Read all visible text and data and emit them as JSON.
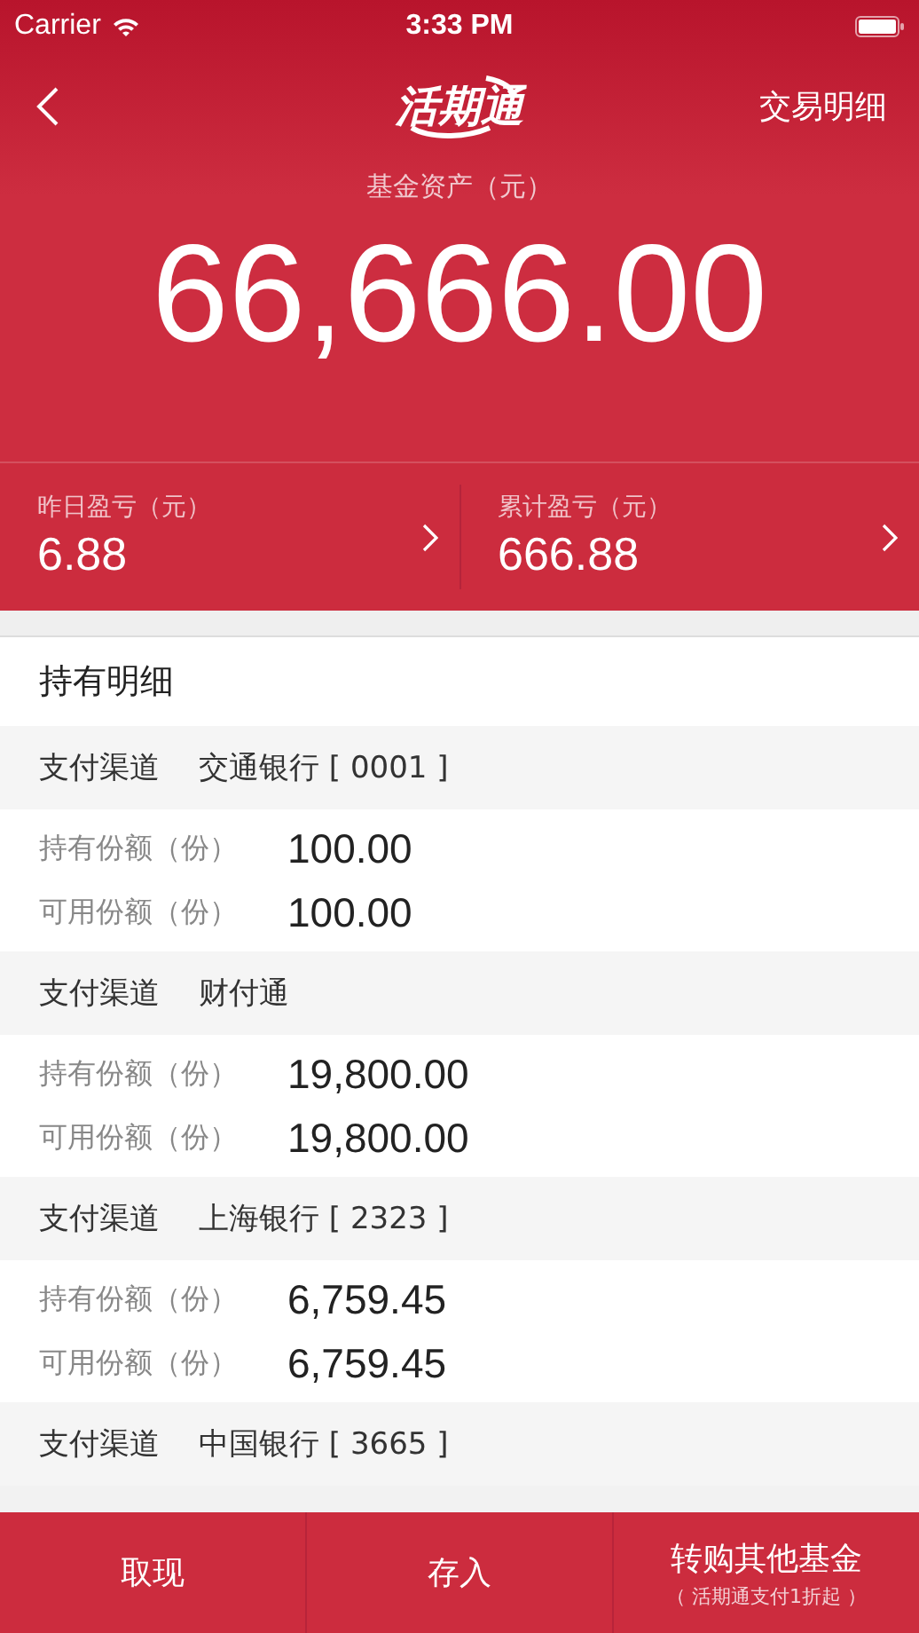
{
  "status_bar": {
    "carrier": "Carrier",
    "time": "3:33 PM"
  },
  "nav": {
    "logo": "活期通",
    "action": "交易明细"
  },
  "asset": {
    "label": "基金资产（元）",
    "value": "66,666.00"
  },
  "stats": [
    {
      "label": "昨日盈亏（元）",
      "value": "6.88"
    },
    {
      "label": "累计盈亏（元）",
      "value": "666.88"
    }
  ],
  "holdings": {
    "title": "持有明细",
    "groups": [
      {
        "channel_label": "支付渠道",
        "channel": "交通银行 [ 0001 ]",
        "rows": [
          {
            "label": "持有份额（份）",
            "value": "100.00"
          },
          {
            "label": "可用份额（份）",
            "value": "100.00"
          }
        ]
      },
      {
        "channel_label": "支付渠道",
        "channel": "财付通",
        "rows": [
          {
            "label": "持有份额（份）",
            "value": "19,800.00"
          },
          {
            "label": "可用份额（份）",
            "value": "19,800.00"
          }
        ]
      },
      {
        "channel_label": "支付渠道",
        "channel": "上海银行 [ 2323 ]",
        "rows": [
          {
            "label": "持有份额（份）",
            "value": "6,759.45"
          },
          {
            "label": "可用份额（份）",
            "value": "6,759.45"
          }
        ]
      },
      {
        "channel_label": "支付渠道",
        "channel": "中国银行 [ 3665 ]"
      }
    ]
  },
  "bottom_bar": [
    {
      "label": "取现"
    },
    {
      "label": "存入"
    },
    {
      "label": "转购其他基金",
      "sublabel": "（ 活期通支付1折起 ）"
    }
  ]
}
